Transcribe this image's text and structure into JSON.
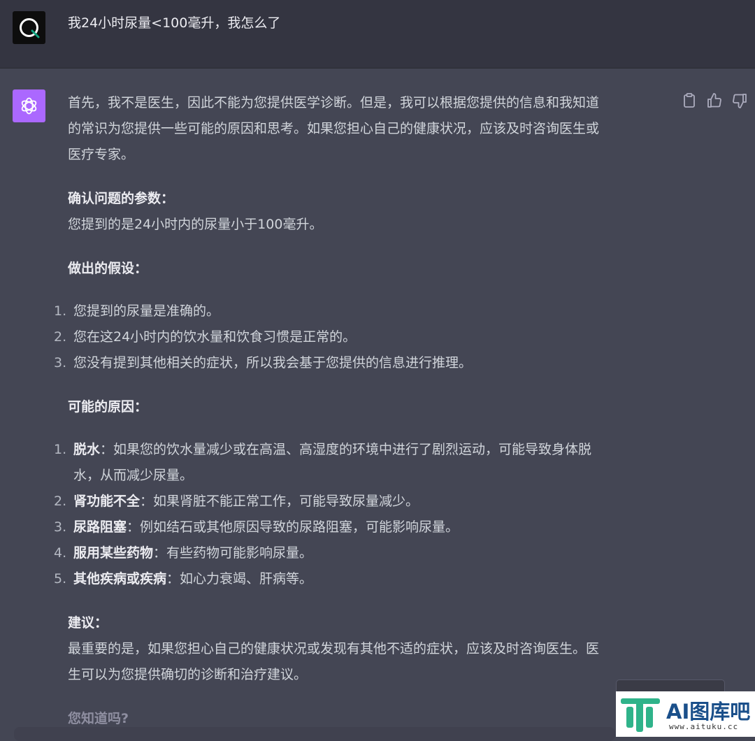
{
  "user_message": {
    "text": "我24小时尿量<100毫升，我怎么了"
  },
  "assistant_message": {
    "intro_lines": [
      "首先，我不是医生，因此不能为您提供医学诊断。但是，我可以根据您提供的信息和我知道",
      "的常识为您提供一些可能的原因和思考。如果您担心自己的健康状况，应该及时咨询医生或",
      "医疗专家。"
    ],
    "section1": {
      "heading": "确认问题的参数：",
      "text": "您提到的是24小时内的尿量小于100毫升。"
    },
    "section2": {
      "heading": "做出的假设：",
      "items": [
        {
          "num": "1.",
          "text": "您提到的尿量是准确的。"
        },
        {
          "num": "2.",
          "text": "您在这24小时内的饮水量和饮食习惯是正常的。"
        },
        {
          "num": "3.",
          "text": "您没有提到其他相关的症状，所以我会基于您提供的信息进行推理。"
        }
      ]
    },
    "section3": {
      "heading": "可能的原因：",
      "items": [
        {
          "num": "1.",
          "bold": "脱水",
          "text": "：如果您的饮水量减少或在高温、高湿度的环境中进行了剧烈运动，可能导致身体脱",
          "text2": "水，从而减少尿量。"
        },
        {
          "num": "2.",
          "bold": "肾功能不全",
          "text": "：如果肾脏不能正常工作，可能导致尿量减少。"
        },
        {
          "num": "3.",
          "bold": "尿路阻塞",
          "text": "：例如结石或其他原因导致的尿路阻塞，可能影响尿量。"
        },
        {
          "num": "4.",
          "bold": "服用某些药物",
          "text": "：有些药物可能影响尿量。"
        },
        {
          "num": "5.",
          "bold": "其他疾病或疾病",
          "text": "：如心力衰竭、肝病等。"
        }
      ]
    },
    "section4": {
      "heading": "建议：",
      "lines": [
        "最重要的是，如果您担心自己的健康状况或发现有其他不适的症状，应该及时咨询医生。医",
        "生可以为您提供确切的诊断和治疗建议。"
      ]
    },
    "section5": {
      "heading": "您知道吗?"
    }
  },
  "watermark": {
    "title": "AI图库吧",
    "url": "www.aituku.cc"
  },
  "icons": {
    "copy": "clipboard-icon",
    "like": "thumbs-up-icon",
    "dislike": "thumbs-down-icon"
  },
  "colors": {
    "user_bg": "#343541",
    "assistant_bg": "#444654",
    "bot_avatar": "#ab68ff"
  }
}
